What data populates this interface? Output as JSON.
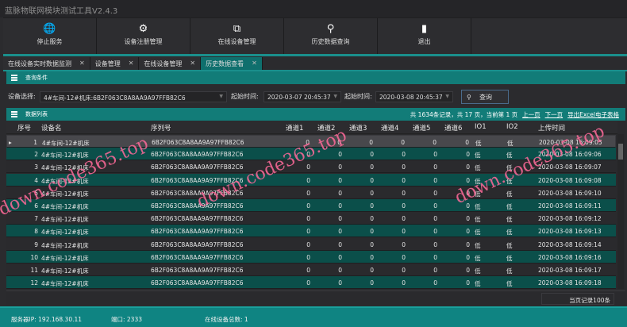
{
  "title": "蓝脉物联网模块测试工具V2.4.3",
  "toolbar": [
    {
      "label": "停止服务",
      "icon": "globe-icon"
    },
    {
      "label": "设备注册管理",
      "icon": "gears-icon"
    },
    {
      "label": "在线设备管理",
      "icon": "network-icon"
    },
    {
      "label": "历史数据查询",
      "icon": "search-icon"
    },
    {
      "label": "退出",
      "icon": "exit-door-icon"
    }
  ],
  "tabs": [
    {
      "label": "在线设备实时数据监测"
    },
    {
      "label": "设备管理"
    },
    {
      "label": "在线设备管理"
    },
    {
      "label": "历史数据查看",
      "active": true
    }
  ],
  "query": {
    "section_title": "查询条件",
    "device_label": "设备选择:",
    "device_value": "4#车间-12#机床:6B2F063C8A8AA9A97FFB82C6",
    "start_label": "起始时间:",
    "start_value": "2020-03-07 20:45:37",
    "end_label": "起始时间:",
    "end_value": "2020-03-08 20:45:37",
    "button": "查询"
  },
  "list": {
    "section_title": "数据列表",
    "pager": {
      "summary": "共 1634条记录，共 17 页，当前第 1 页",
      "prev": "上一页",
      "next": "下一页",
      "export": "导出Excel电子表格"
    },
    "columns": [
      "序号",
      "设备名",
      "序列号",
      "通道1",
      "通道2",
      "通道3",
      "通道4",
      "通道5",
      "通道6",
      "IO1",
      "IO2",
      "上传时间"
    ],
    "rows": [
      [
        "1",
        "4#车间-12#机床",
        "6B2F063C8A8AA9A97FFB82C6",
        "0",
        "0",
        "0",
        "0",
        "0",
        "0",
        "低",
        "低",
        "2020-03-08 16:09:05"
      ],
      [
        "2",
        "4#车间-12#机床",
        "6B2F063C8A8AA9A97FFB82C6",
        "0",
        "0",
        "0",
        "0",
        "0",
        "0",
        "低",
        "低",
        "2020-03-08 16:09:06"
      ],
      [
        "3",
        "4#车间-12#机床",
        "6B2F063C8A8AA9A97FFB82C6",
        "0",
        "0",
        "0",
        "0",
        "0",
        "0",
        "低",
        "低",
        "2020-03-08 16:09:07"
      ],
      [
        "4",
        "4#车间-12#机床",
        "6B2F063C8A8AA9A97FFB82C6",
        "0",
        "0",
        "0",
        "0",
        "0",
        "0",
        "低",
        "低",
        "2020-03-08 16:09:08"
      ],
      [
        "5",
        "4#车间-12#机床",
        "6B2F063C8A8AA9A97FFB82C6",
        "0",
        "0",
        "0",
        "0",
        "0",
        "0",
        "低",
        "低",
        "2020-03-08 16:09:10"
      ],
      [
        "6",
        "4#车间-12#机床",
        "6B2F063C8A8AA9A97FFB82C6",
        "0",
        "0",
        "0",
        "0",
        "0",
        "0",
        "低",
        "低",
        "2020-03-08 16:09:11"
      ],
      [
        "7",
        "4#车间-12#机床",
        "6B2F063C8A8AA9A97FFB82C6",
        "0",
        "0",
        "0",
        "0",
        "0",
        "0",
        "低",
        "低",
        "2020-03-08 16:09:12"
      ],
      [
        "8",
        "4#车间-12#机床",
        "6B2F063C8A8AA9A97FFB82C6",
        "0",
        "0",
        "0",
        "0",
        "0",
        "0",
        "低",
        "低",
        "2020-03-08 16:09:13"
      ],
      [
        "9",
        "4#车间-12#机床",
        "6B2F063C8A8AA9A97FFB82C6",
        "0",
        "0",
        "0",
        "0",
        "0",
        "0",
        "低",
        "低",
        "2020-03-08 16:09:14"
      ],
      [
        "10",
        "4#车间-12#机床",
        "6B2F063C8A8AA9A97FFB82C6",
        "0",
        "0",
        "0",
        "0",
        "0",
        "0",
        "低",
        "低",
        "2020-03-08 16:09:16"
      ],
      [
        "11",
        "4#车间-12#机床",
        "6B2F063C8A8AA9A97FFB82C6",
        "0",
        "0",
        "0",
        "0",
        "0",
        "0",
        "低",
        "低",
        "2020-03-08 16:09:17"
      ],
      [
        "12",
        "4#车间-12#机床",
        "6B2F063C8A8AA9A97FFB82C6",
        "0",
        "0",
        "0",
        "0",
        "0",
        "0",
        "低",
        "低",
        "2020-03-08 16:09:18"
      ]
    ],
    "page_records": "当页记录100条"
  },
  "status": {
    "server_ip": "服务器IP:  192.168.30.11",
    "port": "端口:  2333",
    "online_total": "在线设备总数:  1"
  },
  "watermark": "down.code365.top",
  "colors": {
    "teal": "#127c78",
    "row_teal": "#0b4f4a",
    "background": "#2b2b2e"
  }
}
